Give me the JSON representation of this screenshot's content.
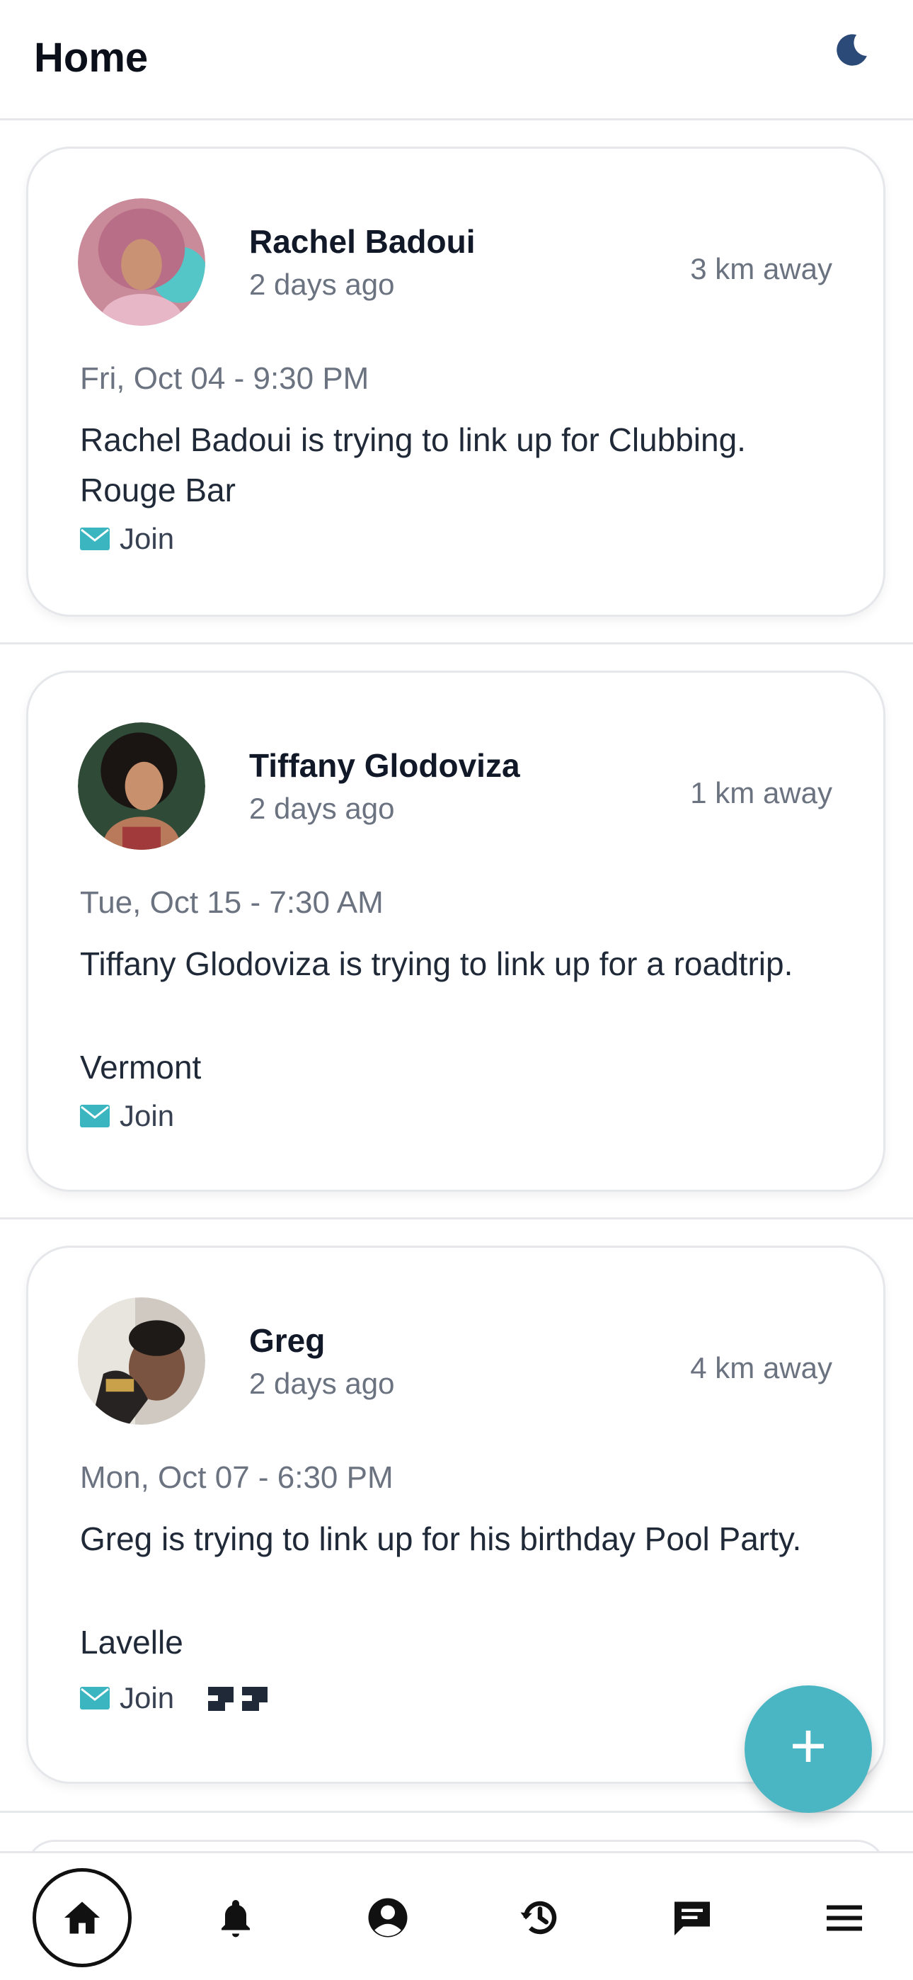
{
  "header": {
    "title": "Home"
  },
  "posts": [
    {
      "name": "Rachel Badoui",
      "time": "2 days ago",
      "distance": "3 km away",
      "date": "Fri, Oct 04 - 9:30 PM",
      "description": "Rachel Badoui is trying to link up for Clubbing.",
      "location": "Rouge Bar",
      "join_label": "Join"
    },
    {
      "name": "Tiffany Glodoviza",
      "time": "2 days ago",
      "distance": "1 km away",
      "date": "Tue, Oct 15 - 7:30 AM",
      "description": "Tiffany Glodoviza is trying to link up for a roadtrip.",
      "location": "Vermont",
      "join_label": "Join"
    },
    {
      "name": "Greg",
      "time": "2 days ago",
      "distance": "4 km away",
      "date": "Mon, Oct 07 - 6:30 PM",
      "description": "Greg is trying to link up for his birthday Pool Party.",
      "location": "Lavelle",
      "join_label": "Join"
    }
  ],
  "fab": {
    "label": "+"
  },
  "icons": {
    "theme": "moon-icon",
    "join": "envelope-icon",
    "nav": [
      "home-icon",
      "bell-icon",
      "user-circle-icon",
      "history-icon",
      "chat-icon",
      "menu-icon"
    ]
  },
  "colors": {
    "accent": "#4bb6c3",
    "moon": "#2b4a78",
    "muted": "#6b7280"
  }
}
